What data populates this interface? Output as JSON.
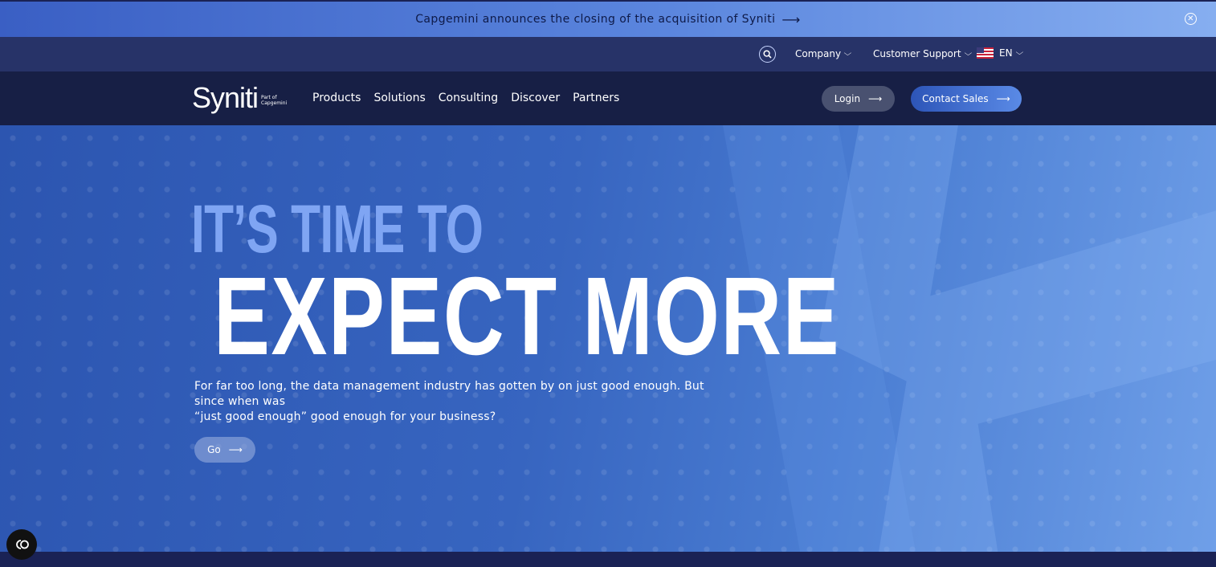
{
  "announcement": {
    "text": "Capgemini announces the closing of the acquisition of Syniti",
    "arrow": "⟶",
    "close_icon": "close-circle-icon"
  },
  "utility_nav": {
    "items": [
      {
        "label": "Company",
        "chevron": "⌵"
      },
      {
        "label": "Customer Support",
        "chevron": "⌵"
      }
    ],
    "language": {
      "label": "EN",
      "chevron": "⌵",
      "flag_icon": "us-flag-icon"
    }
  },
  "main_nav": {
    "logo": {
      "word": "Syniti",
      "sub1": "Part of",
      "sub2": "Capgemini"
    },
    "links": [
      "Products",
      "Solutions",
      "Consulting",
      "Discover",
      "Partners"
    ],
    "login": {
      "label": "Login",
      "arrow": "⟶"
    },
    "contact": {
      "label": "Contact Sales",
      "arrow": "⟶"
    }
  },
  "hero": {
    "line1": "IT’S TIME TO",
    "line2": "EXPECT MORE",
    "para1": "For far too long, the data management industry has gotten by on just good enough. But since when was",
    "para2": "“just good enough” good enough for your business?",
    "go": {
      "label": "Go",
      "arrow": "⟶"
    }
  },
  "colors": {
    "accent": "#2d55b8",
    "hero_bg": "#3765c0",
    "nav_bg": "#171f45"
  }
}
